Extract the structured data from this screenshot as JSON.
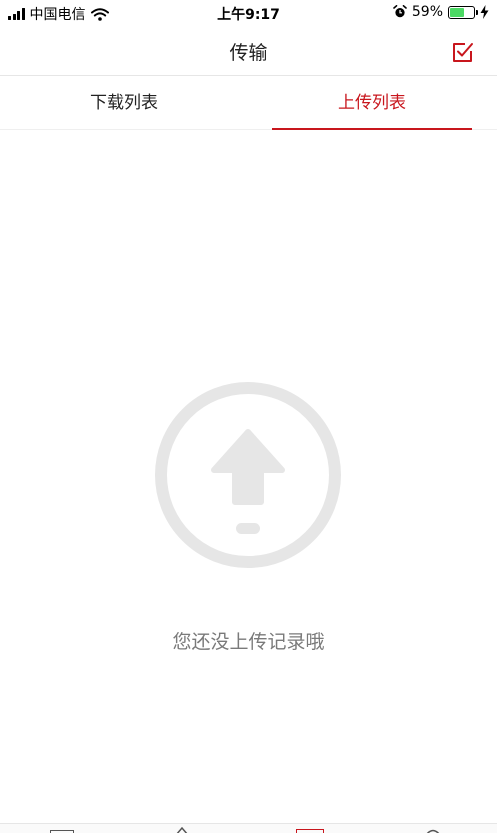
{
  "status_bar": {
    "carrier": "中国电信",
    "time": "上午9:17",
    "battery_percent": "59%",
    "battery_level": 0.59,
    "battery_color": "#4cd964"
  },
  "nav": {
    "title": "传输",
    "edit_icon": "checklist-edit-icon"
  },
  "tabs": [
    {
      "label": "下载列表",
      "active": false
    },
    {
      "label": "上传列表",
      "active": true
    }
  ],
  "empty_state": {
    "icon": "upload-circle-icon",
    "message": "您还没上传记录哦"
  },
  "colors": {
    "accent": "#c8161d",
    "muted_text": "#7a7a7a",
    "icon_gray": "#e6e6e6"
  }
}
